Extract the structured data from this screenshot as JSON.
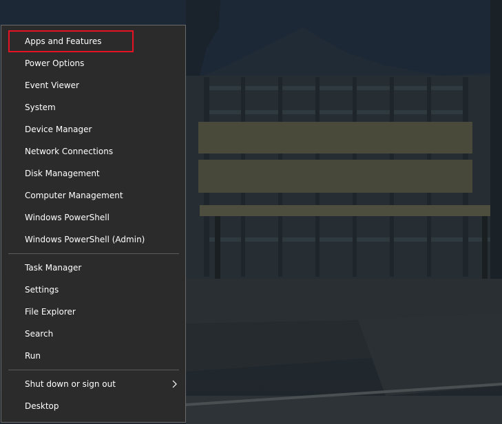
{
  "menu": {
    "items": [
      {
        "label": "Apps and Features",
        "highlighted": true
      },
      {
        "label": "Power Options"
      },
      {
        "label": "Event Viewer"
      },
      {
        "label": "System"
      },
      {
        "label": "Device Manager"
      },
      {
        "label": "Network Connections"
      },
      {
        "label": "Disk Management"
      },
      {
        "label": "Computer Management"
      },
      {
        "label": "Windows PowerShell"
      },
      {
        "label": "Windows PowerShell (Admin)"
      }
    ],
    "group2": [
      {
        "label": "Task Manager"
      },
      {
        "label": "Settings"
      },
      {
        "label": "File Explorer"
      },
      {
        "label": "Search"
      },
      {
        "label": "Run"
      }
    ],
    "group3": [
      {
        "label": "Shut down or sign out",
        "submenu_icon": "chevron-right-icon"
      },
      {
        "label": "Desktop"
      }
    ]
  },
  "colors": {
    "menu_background": "#2b2b2b",
    "menu_text": "#ffffff",
    "highlight_border": "#e81123"
  }
}
